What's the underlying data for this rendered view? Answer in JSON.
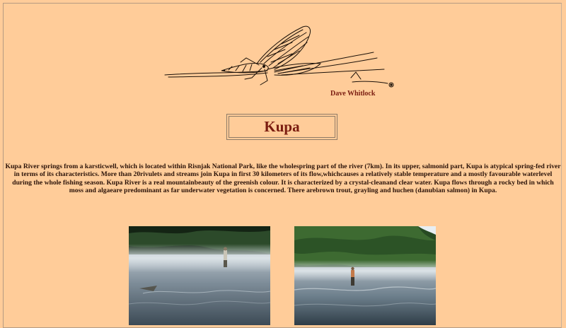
{
  "header": {
    "illustration_icon": "mayfly-illustration",
    "credit": "Dave Whitlock"
  },
  "page": {
    "title": "Kupa"
  },
  "main": {
    "description": "Kupa River springs from a karsticwell, which is located within Risnjak National Park, like the wholespring part of the river (7km). In its upper, salmonid part, Kupa is atypical spring-fed river in terms of its characteristics. More than 20rivulets and streams join Kupa in first 30 kilometers of its flow,whichcauses a relatively stable temperature and a mostly favourable waterlevel during the whole fishing season. Kupa River is a real mountainbeauty of the greenish colour. It is characterized by a crystal-cleanand clear water. Kupa flows through a rocky bed in which moss and algaeare predominant as far underwater vegetation is concerned. There arebrown trout, grayling and huchen (danubian salmon) in Kupa."
  },
  "gallery": {
    "photos": [
      {
        "subject": "angler-in-misty-river"
      },
      {
        "subject": "angler-wading-river"
      }
    ]
  },
  "colors": {
    "background": "#ffcc99",
    "title": "#7a1c10",
    "text": "#2a1208"
  }
}
